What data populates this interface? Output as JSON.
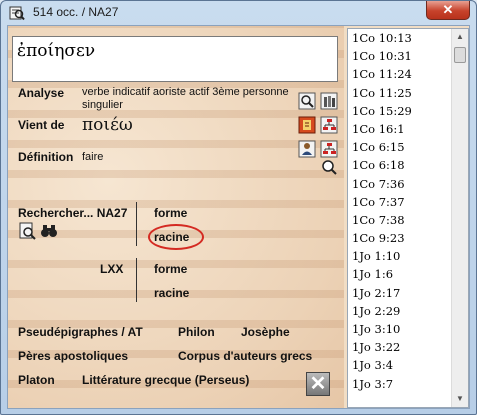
{
  "window": {
    "title": "514 occ. / NA27",
    "close_glyph": "✕",
    "icon": "magnifier-book-icon"
  },
  "word": "ἐποίησεν",
  "analyse": {
    "label": "Analyse",
    "value": "verbe indicatif aoriste actif 3ème personne singulier"
  },
  "vient_de": {
    "label": "Vient de",
    "value": "ποιέω"
  },
  "definition": {
    "label": "Définition",
    "value": "faire"
  },
  "rechercher": {
    "label": "Rechercher... NA27",
    "forme": "forme",
    "racine": "racine"
  },
  "lxx": {
    "label": "LXX",
    "forme": "forme",
    "racine": "racine"
  },
  "links": {
    "pseudepigraphes": "Pseudépigraphes / AT",
    "philon": "Philon",
    "josephe": "Josèphe",
    "peres": "Pères apostoliques",
    "corpus": "Corpus d'auteurs grecs",
    "platon": "Platon",
    "perseus": "Littérature grecque (Perseus)"
  },
  "close_button_glyph": "✕",
  "references": [
    "1Co 10:13",
    "1Co 10:31",
    "1Co 11:24",
    "1Co 11:25",
    "1Co 15:29",
    "1Co 16:1",
    "1Co 6:15",
    "1Co 6:18",
    "1Co 7:36",
    "1Co 7:37",
    "1Co 7:38",
    "1Co 9:23",
    "1Jo 1:10",
    "1Jo 1:6",
    "1Jo 2:17",
    "1Jo 2:29",
    "1Jo 3:10",
    "1Jo 3:22",
    "1Jo 3:4",
    "1Jo 3:7"
  ],
  "colors": {
    "highlight_circle": "#d42a22",
    "title_close": "#c7422b"
  }
}
